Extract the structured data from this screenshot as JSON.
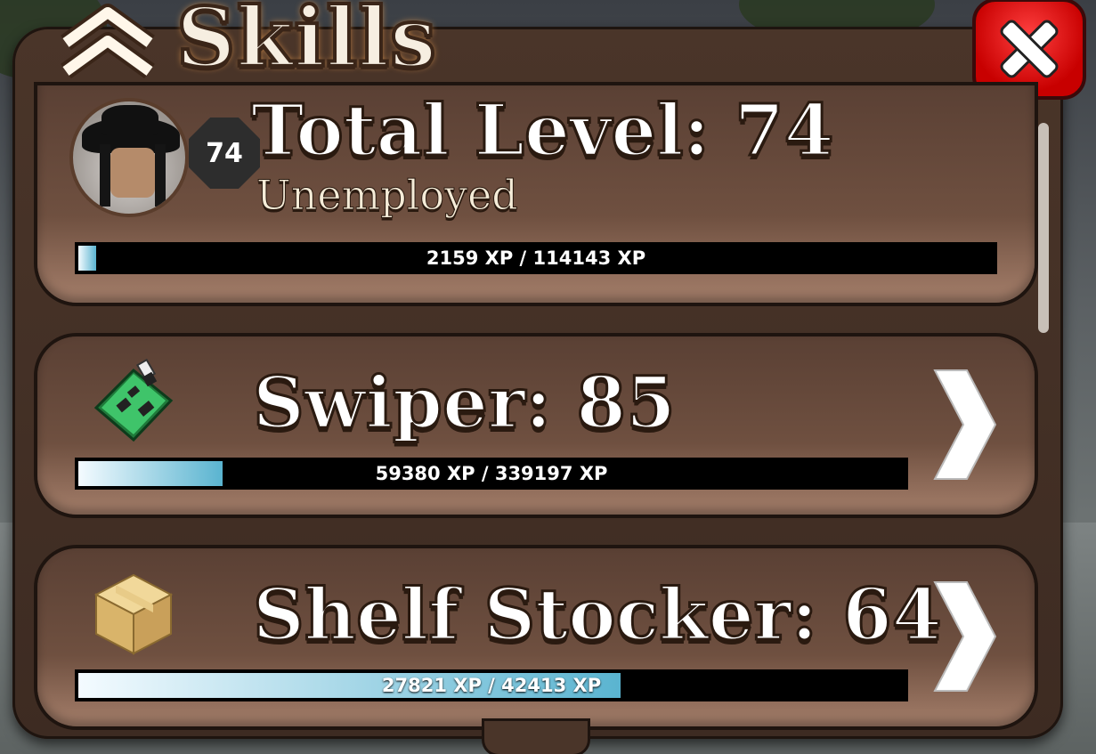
{
  "window": {
    "title": "Skills"
  },
  "header": {
    "title": "Skills",
    "close_icon": "close-icon",
    "accent": "#d00000"
  },
  "overview": {
    "level_badge": "74",
    "total_label": "Total Level: 74",
    "job": "Unemployed",
    "xp_text": "2159 XP / 114143 XP",
    "progress": 0.019
  },
  "skills": [
    {
      "name": "Swiper: 85",
      "icon": "circuit-board-icon",
      "xp_text": "59380 XP / 339197 XP",
      "progress": 0.175
    },
    {
      "name": "Shelf Stocker: 64",
      "icon": "cardboard-box-icon",
      "xp_text": "27821 XP / 42413 XP",
      "progress": 0.656
    }
  ],
  "colors": {
    "panel": "#4a3529",
    "bar_fill": "#5ab4d0",
    "close": "#d00000"
  }
}
